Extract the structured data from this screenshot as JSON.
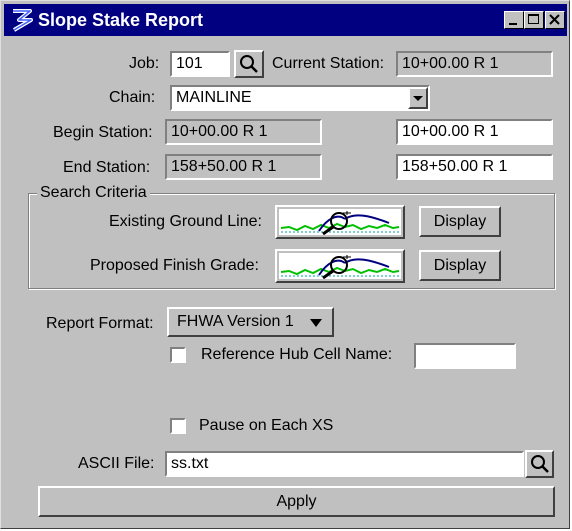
{
  "window": {
    "title": "Slope Stake Report"
  },
  "job": {
    "label": "Job:",
    "value": "101",
    "current_station_label": "Current Station:",
    "current_station_value": "10+00.00 R 1"
  },
  "chain": {
    "label": "Chain:",
    "value": "MAINLINE"
  },
  "begin_station": {
    "label": "Begin Station:",
    "value": "10+00.00 R 1",
    "input_value": "10+00.00 R 1"
  },
  "end_station": {
    "label": "End Station:",
    "value": "158+50.00 R 1",
    "input_value": "158+50.00 R 1"
  },
  "search_criteria": {
    "title": "Search Criteria",
    "existing_label": "Existing Ground Line:",
    "proposed_label": "Proposed Finish Grade:",
    "display_label": "Display"
  },
  "report_format": {
    "label": "Report Format:",
    "value": "FHWA Version 1"
  },
  "reference_hub": {
    "label": "Reference Hub Cell Name:",
    "value": "",
    "checked": false
  },
  "pause": {
    "label": "Pause on Each XS",
    "checked": false
  },
  "ascii_file": {
    "label": "ASCII File:",
    "value": "ss.txt"
  },
  "apply_label": "Apply",
  "icons": [
    "app-icon",
    "minimize-icon",
    "maximize-icon",
    "close-icon",
    "magnifier-icon",
    "dropdown-arrow-icon",
    "graph-icon"
  ]
}
